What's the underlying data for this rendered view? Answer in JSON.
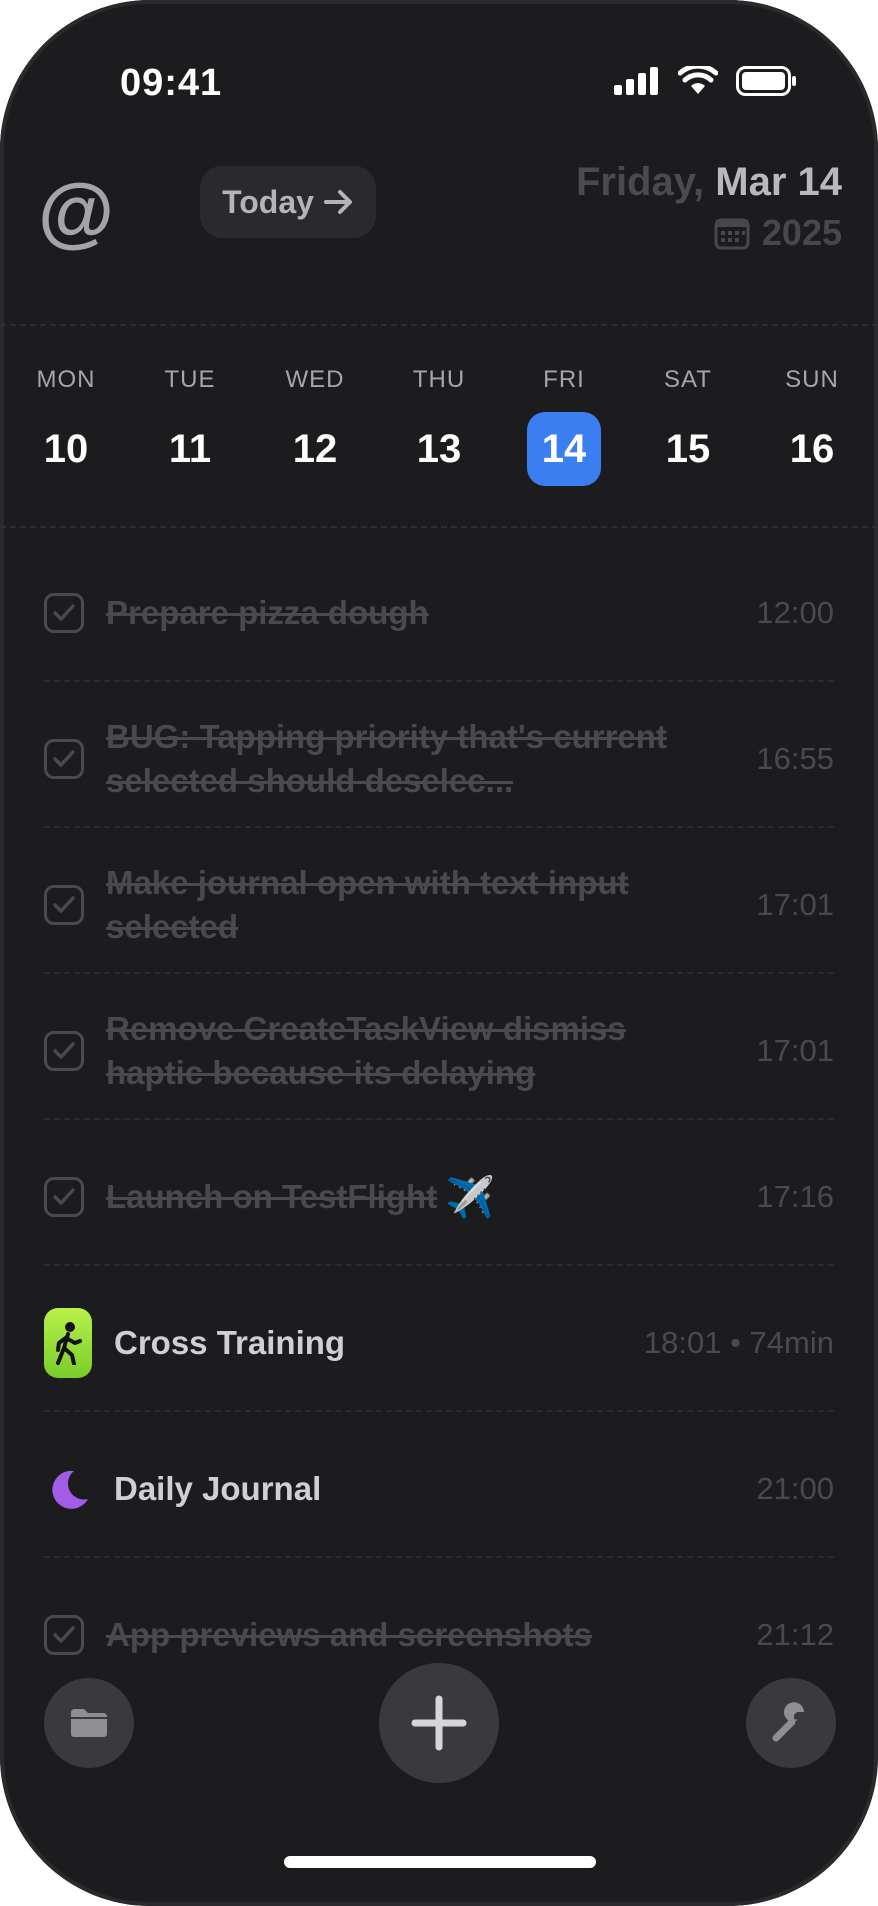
{
  "status_bar": {
    "time": "09:41"
  },
  "header": {
    "logo": "@",
    "today_button": "Today",
    "weekday": "Friday,",
    "month_day": "Mar 14",
    "year": "2025"
  },
  "week": [
    {
      "label": "MON",
      "num": "10"
    },
    {
      "label": "TUE",
      "num": "11"
    },
    {
      "label": "WED",
      "num": "12"
    },
    {
      "label": "THU",
      "num": "13"
    },
    {
      "label": "FRI",
      "num": "14",
      "selected": true
    },
    {
      "label": "SAT",
      "num": "15"
    },
    {
      "label": "SUN",
      "num": "16"
    }
  ],
  "tasks": [
    {
      "title": "Prepare pizza dough",
      "time": "12:00",
      "done": true
    },
    {
      "title": "BUG: Tapping priority that's current selected should deselec...",
      "time": "16:55",
      "done": true
    },
    {
      "title": "Make journal open with text input selected",
      "time": "17:01",
      "done": true
    },
    {
      "title": "Remove CreateTaskView dismiss haptic because its delaying",
      "time": "17:01",
      "done": true
    },
    {
      "title": "Launch on TestFlight",
      "emoji": "✈️",
      "time": "17:16",
      "done": true
    },
    {
      "title": "Cross Training",
      "time": "18:01 • 74min",
      "done": false,
      "icon": "walking-icon"
    },
    {
      "title": "Daily Journal",
      "time": "21:00",
      "done": false,
      "icon": "moon-icon"
    },
    {
      "title": "App previews and screenshots",
      "time": "21:12",
      "done": true
    }
  ],
  "colors": {
    "accent": "#3a7ef0",
    "background": "#1c1b1e",
    "workout_badge": "#9be03a",
    "journal_moon": "#a35ce8"
  },
  "bottom_bar": {
    "left": "folder-icon",
    "center": "plus-icon",
    "right": "wrench-icon"
  }
}
